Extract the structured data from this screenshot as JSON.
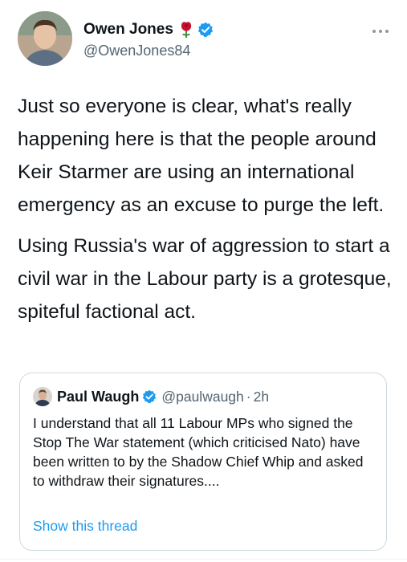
{
  "tweet": {
    "author": {
      "display_name": "Owen Jones",
      "handle": "@OwenJones84",
      "badges": [
        "rose-icon",
        "verified-icon"
      ]
    },
    "paragraphs": [
      "Just so everyone is clear, what's really happening here is that the people around Keir Starmer are using an international emergency as an excuse to purge the left.",
      "Using Russia's war of aggression to start a civil war in the Labour party is a grotesque, spiteful factional act."
    ],
    "quoted": {
      "display_name": "Paul Waugh",
      "handle": "@paulwaugh",
      "separator": "·",
      "time": "2h",
      "text": "I understand that all 11 Labour MPs who signed the Stop The War statement (which criticised Nato) have been written to by the Shadow Chief Whip and asked to withdraw their signatures....",
      "show_thread_label": "Show this thread"
    }
  },
  "colors": {
    "text_primary": "#0f1419",
    "text_secondary": "#536471",
    "accent": "#1d9bf0",
    "border": "#cfd9de",
    "rose": "#c8102e"
  }
}
